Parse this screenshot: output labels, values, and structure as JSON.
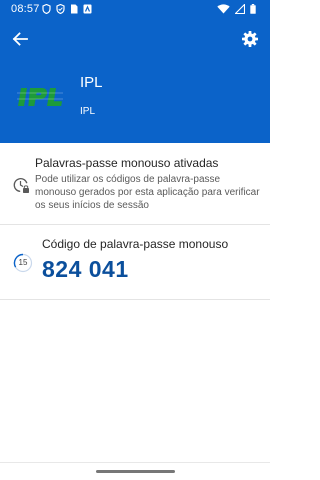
{
  "status_bar": {
    "time": "08:57",
    "left_icons": [
      "shield-icon",
      "shield-check-icon",
      "sim-card-icon",
      "square-alert-icon"
    ],
    "right_icons": [
      "wifi-icon",
      "signal-icon",
      "battery-icon"
    ]
  },
  "header": {
    "back_icon": "back-arrow-icon",
    "settings_icon": "gear-icon",
    "account_name": "IPL",
    "account_username": "IPL",
    "logo_text": "IPL",
    "accent_color": "#0b63c9",
    "logo_color": "#1d9b3a"
  },
  "otp_section": {
    "enabled_title": "Palavras-passe monouso ativadas",
    "enabled_description": "Pode utilizar os códigos de palavra-passe monouso gerados por esta aplicação para verificar os seus inícios de sessão",
    "enabled_icon": "clock-lock-icon"
  },
  "code_section": {
    "label": "Código de palavra-passe monouso",
    "code": "824 041",
    "countdown": "15",
    "code_color": "#0b4f9c"
  }
}
